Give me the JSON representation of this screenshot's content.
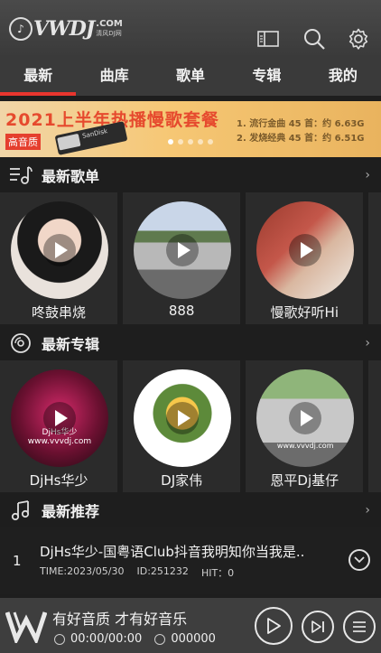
{
  "header": {
    "logo_word": "VWDJ",
    "logo_domain": ".COM",
    "logo_sub": "清风DJ网",
    "icons": [
      "sidebar-icon",
      "search-icon",
      "gear-icon"
    ]
  },
  "tabs": [
    "最新",
    "曲库",
    "歌单",
    "专辑",
    "我的"
  ],
  "banner": {
    "title": "2021上半年热播慢歌套餐",
    "badge": "高音质",
    "card_text": "SanDisk",
    "line1": "1. 流行金曲 45 首：约 6.63G",
    "line2": "2. 发烧经典 45 首：约 6.51G"
  },
  "sections": {
    "playlists": {
      "label": "最新歌单",
      "chevron": "›"
    },
    "albums": {
      "label": "最新专辑",
      "chevron": "›"
    },
    "recommend": {
      "label": "最新推荐",
      "chevron": "›"
    }
  },
  "playlists": [
    {
      "name": "咚鼓串烧"
    },
    {
      "name": "888"
    },
    {
      "name": "慢歌好听Hi"
    }
  ],
  "albums": [
    {
      "name": "DjHs华少",
      "art_text": "DjHs华少 www.vvvdj.com"
    },
    {
      "name": "DJ家伟"
    },
    {
      "name": "恩平Dj基仔",
      "art_text": "www.vvvdj.com"
    }
  ],
  "recommend": [
    {
      "index": "1",
      "title": "DjHs华少-国粤语Club抖音我明知你当我是..",
      "time": "TIME:2023/05/30",
      "id": "ID:251232",
      "hit": "HIT：0"
    }
  ],
  "player": {
    "slogan": "有好音质 才有好音乐",
    "time": "00:00/00:00",
    "id": "000000"
  }
}
